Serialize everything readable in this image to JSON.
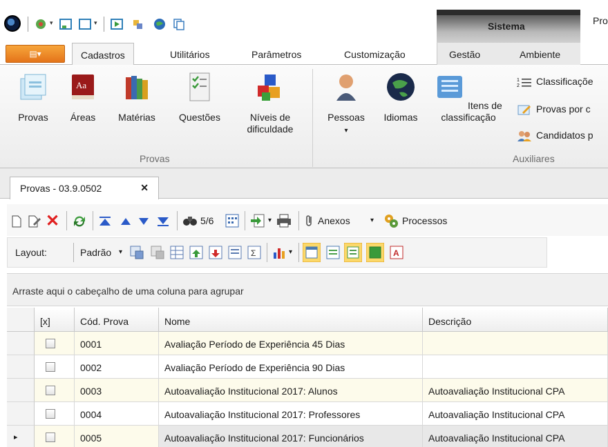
{
  "quick_access": {
    "items": [
      "app-orb-icon",
      "network-icon",
      "form-icon",
      "window-icon",
      "play-icon",
      "tools-icon",
      "globe-icon",
      "copy-icon"
    ],
    "sistema_label": "Sistema",
    "pro_label": "Pro"
  },
  "ribbon_tabs": {
    "app_menu": "▤▾",
    "items": [
      "Cadastros",
      "Utilitários",
      "Parâmetros",
      "Customização",
      "Gestão",
      "Ambiente"
    ],
    "active": "Cadastros"
  },
  "ribbon": {
    "buttons": [
      {
        "label": "Provas",
        "icon": "document-stack-icon"
      },
      {
        "label": "Áreas",
        "icon": "dictionary-icon"
      },
      {
        "label": "Matérias",
        "icon": "books-icon"
      },
      {
        "label": "Questões",
        "icon": "checklist-icon"
      },
      {
        "label": "Níveis de dificuldade",
        "icon": "colored-cubes-icon"
      },
      {
        "label": "Pessoas",
        "icon": "person-icon"
      },
      {
        "label": "Idiomas",
        "icon": "globe-icon"
      },
      {
        "label": "Itens de classificação",
        "icon": "list-panel-icon"
      }
    ],
    "pessoas_dropdown": "▾",
    "small_buttons": [
      "Classificaçõe",
      "Provas por c",
      "Candidatos p"
    ],
    "groups": [
      "Provas",
      "Auxiliares"
    ]
  },
  "document_tab": {
    "label": "Provas - 03.9.0502",
    "close": "✕"
  },
  "toolbar": {
    "record_position": "5/6",
    "anexos_label": "Anexos",
    "processos_label": "Processos",
    "layout_label": "Layout:",
    "padrao_label": "Padrão"
  },
  "grid": {
    "group_hint": "Arraste aqui o cabeçalho de uma coluna para agrupar",
    "columns": [
      "[x]",
      "Cód. Prova",
      "Nome",
      "Descrição"
    ],
    "rows": [
      {
        "code": "0001",
        "name": "Avaliação Período de Experiência 45 Dias",
        "desc": ""
      },
      {
        "code": "0002",
        "name": "Avaliação Período de Experiência 90 Dias",
        "desc": ""
      },
      {
        "code": "0003",
        "name": "Autoavaliação Institucional 2017: Alunos",
        "desc": "Autoavaliação Institucional CPA"
      },
      {
        "code": "0004",
        "name": "Autoavaliação Institucional 2017: Professores",
        "desc": "Autoavaliação Institucional CPA"
      },
      {
        "code": "0005",
        "name": "Autoavaliação Institucional 2017: Funcionários",
        "desc": "Autoavaliação Institucional CPA"
      }
    ],
    "current_row_marker": "▸"
  },
  "colors": {
    "accent_orange": "#e4741a",
    "row_highlight": "#fdfbeb",
    "selected_row": "#e8e8e8"
  }
}
